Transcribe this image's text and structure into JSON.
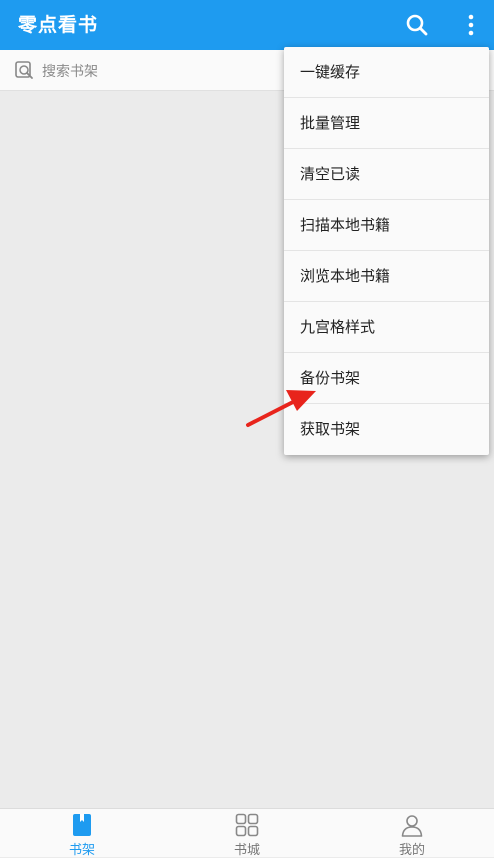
{
  "app": {
    "title": "零点看书",
    "accent_color": "#1e9bf0"
  },
  "searchbar": {
    "placeholder": "搜索书架"
  },
  "menu": {
    "items": [
      {
        "label": "一键缓存"
      },
      {
        "label": "批量管理"
      },
      {
        "label": "清空已读"
      },
      {
        "label": "扫描本地书籍"
      },
      {
        "label": "浏览本地书籍"
      },
      {
        "label": "九宫格样式"
      },
      {
        "label": "备份书架"
      },
      {
        "label": "获取书架"
      }
    ]
  },
  "annotation": {
    "arrow_color": "#e8241c"
  },
  "bottom_nav": {
    "items": [
      {
        "label": "书架",
        "icon": "bookshelf-icon",
        "active": true
      },
      {
        "label": "书城",
        "icon": "grid-icon",
        "active": false
      },
      {
        "label": "我的",
        "icon": "person-icon",
        "active": false
      }
    ]
  }
}
